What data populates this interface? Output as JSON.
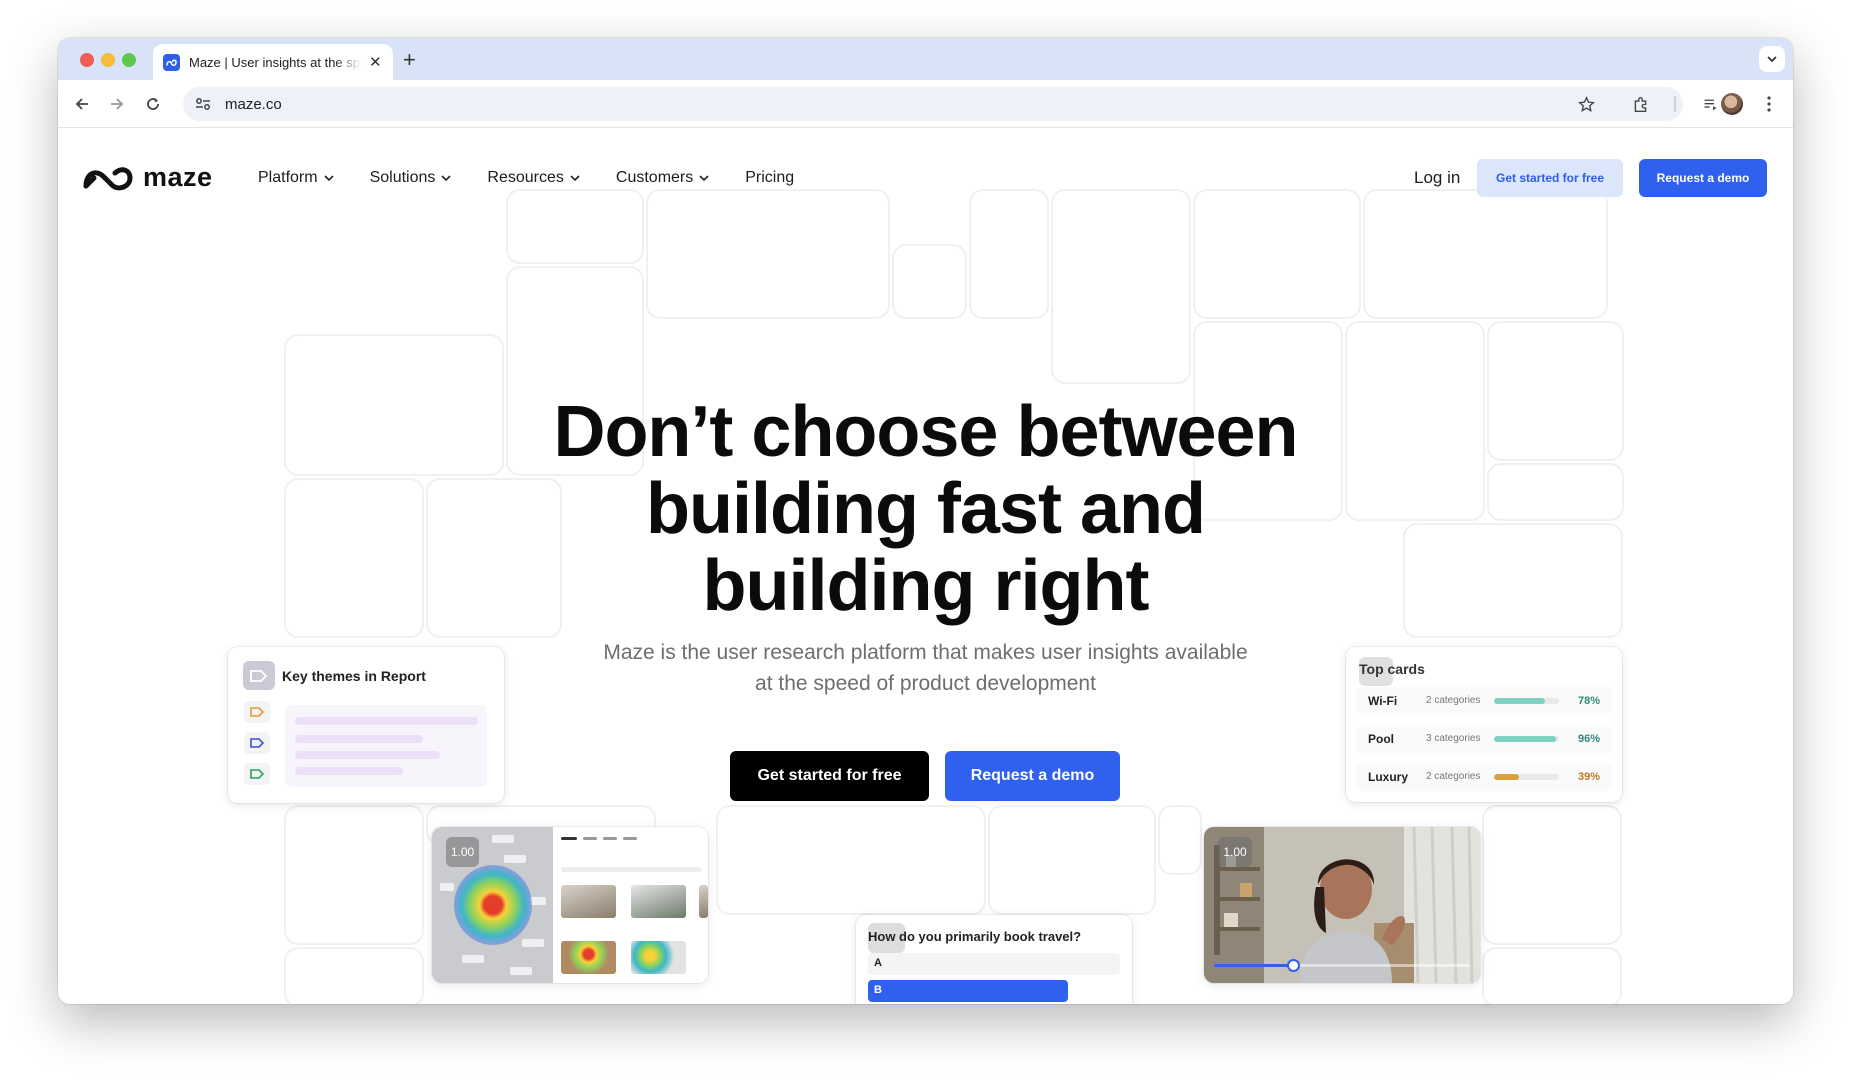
{
  "browser": {
    "tab_title": "Maze | User insights at the speed of product development",
    "new_tab": "+",
    "close": "✕",
    "url": "maze.co"
  },
  "nav": {
    "logo_text": "maze",
    "items": [
      {
        "label": "Platform"
      },
      {
        "label": "Solutions"
      },
      {
        "label": "Resources"
      },
      {
        "label": "Customers"
      },
      {
        "label": "Pricing"
      }
    ],
    "login": "Log in",
    "get_started": "Get started for free",
    "request_demo": "Request a demo"
  },
  "hero": {
    "title_line1": "Don’t choose between",
    "title_line2": "building fast and",
    "title_line3": "building right",
    "subtitle_line1": "Maze is the user research platform that makes user insights available",
    "subtitle_line2": "at the speed of product development",
    "cta_primary": "Get started for free",
    "cta_secondary": "Request a demo"
  },
  "themes_card": {
    "title": "Key themes in Report",
    "tag_colors": [
      "#e09a3a",
      "#3b4fd8",
      "#2f9e5a"
    ]
  },
  "top_cards": {
    "title": "Top cards",
    "rows": [
      {
        "name": "Wi-Fi",
        "categories": "2 categories",
        "percent": "78%",
        "fill": 0.78,
        "color": "#7ed1c3",
        "text_color": "#2e8b7a"
      },
      {
        "name": "Pool",
        "categories": "3 categories",
        "percent": "96%",
        "fill": 0.96,
        "color": "#7ed1c3",
        "text_color": "#2e8b7a"
      },
      {
        "name": "Luxury",
        "categories": "2 categories",
        "percent": "39%",
        "fill": 0.39,
        "color": "#d9a13c",
        "text_color": "#b7791f"
      }
    ]
  },
  "heatmap_card": {
    "badge": "1.00"
  },
  "survey_card": {
    "question": "How do you primarily book travel?",
    "option_a": "A",
    "option_b": "B"
  },
  "video_card": {
    "badge": "1.00",
    "progress": 0.31
  },
  "colors": {
    "brand_blue": "#2f60ee",
    "light_blue": "#dce6fb",
    "black": "#000000"
  }
}
